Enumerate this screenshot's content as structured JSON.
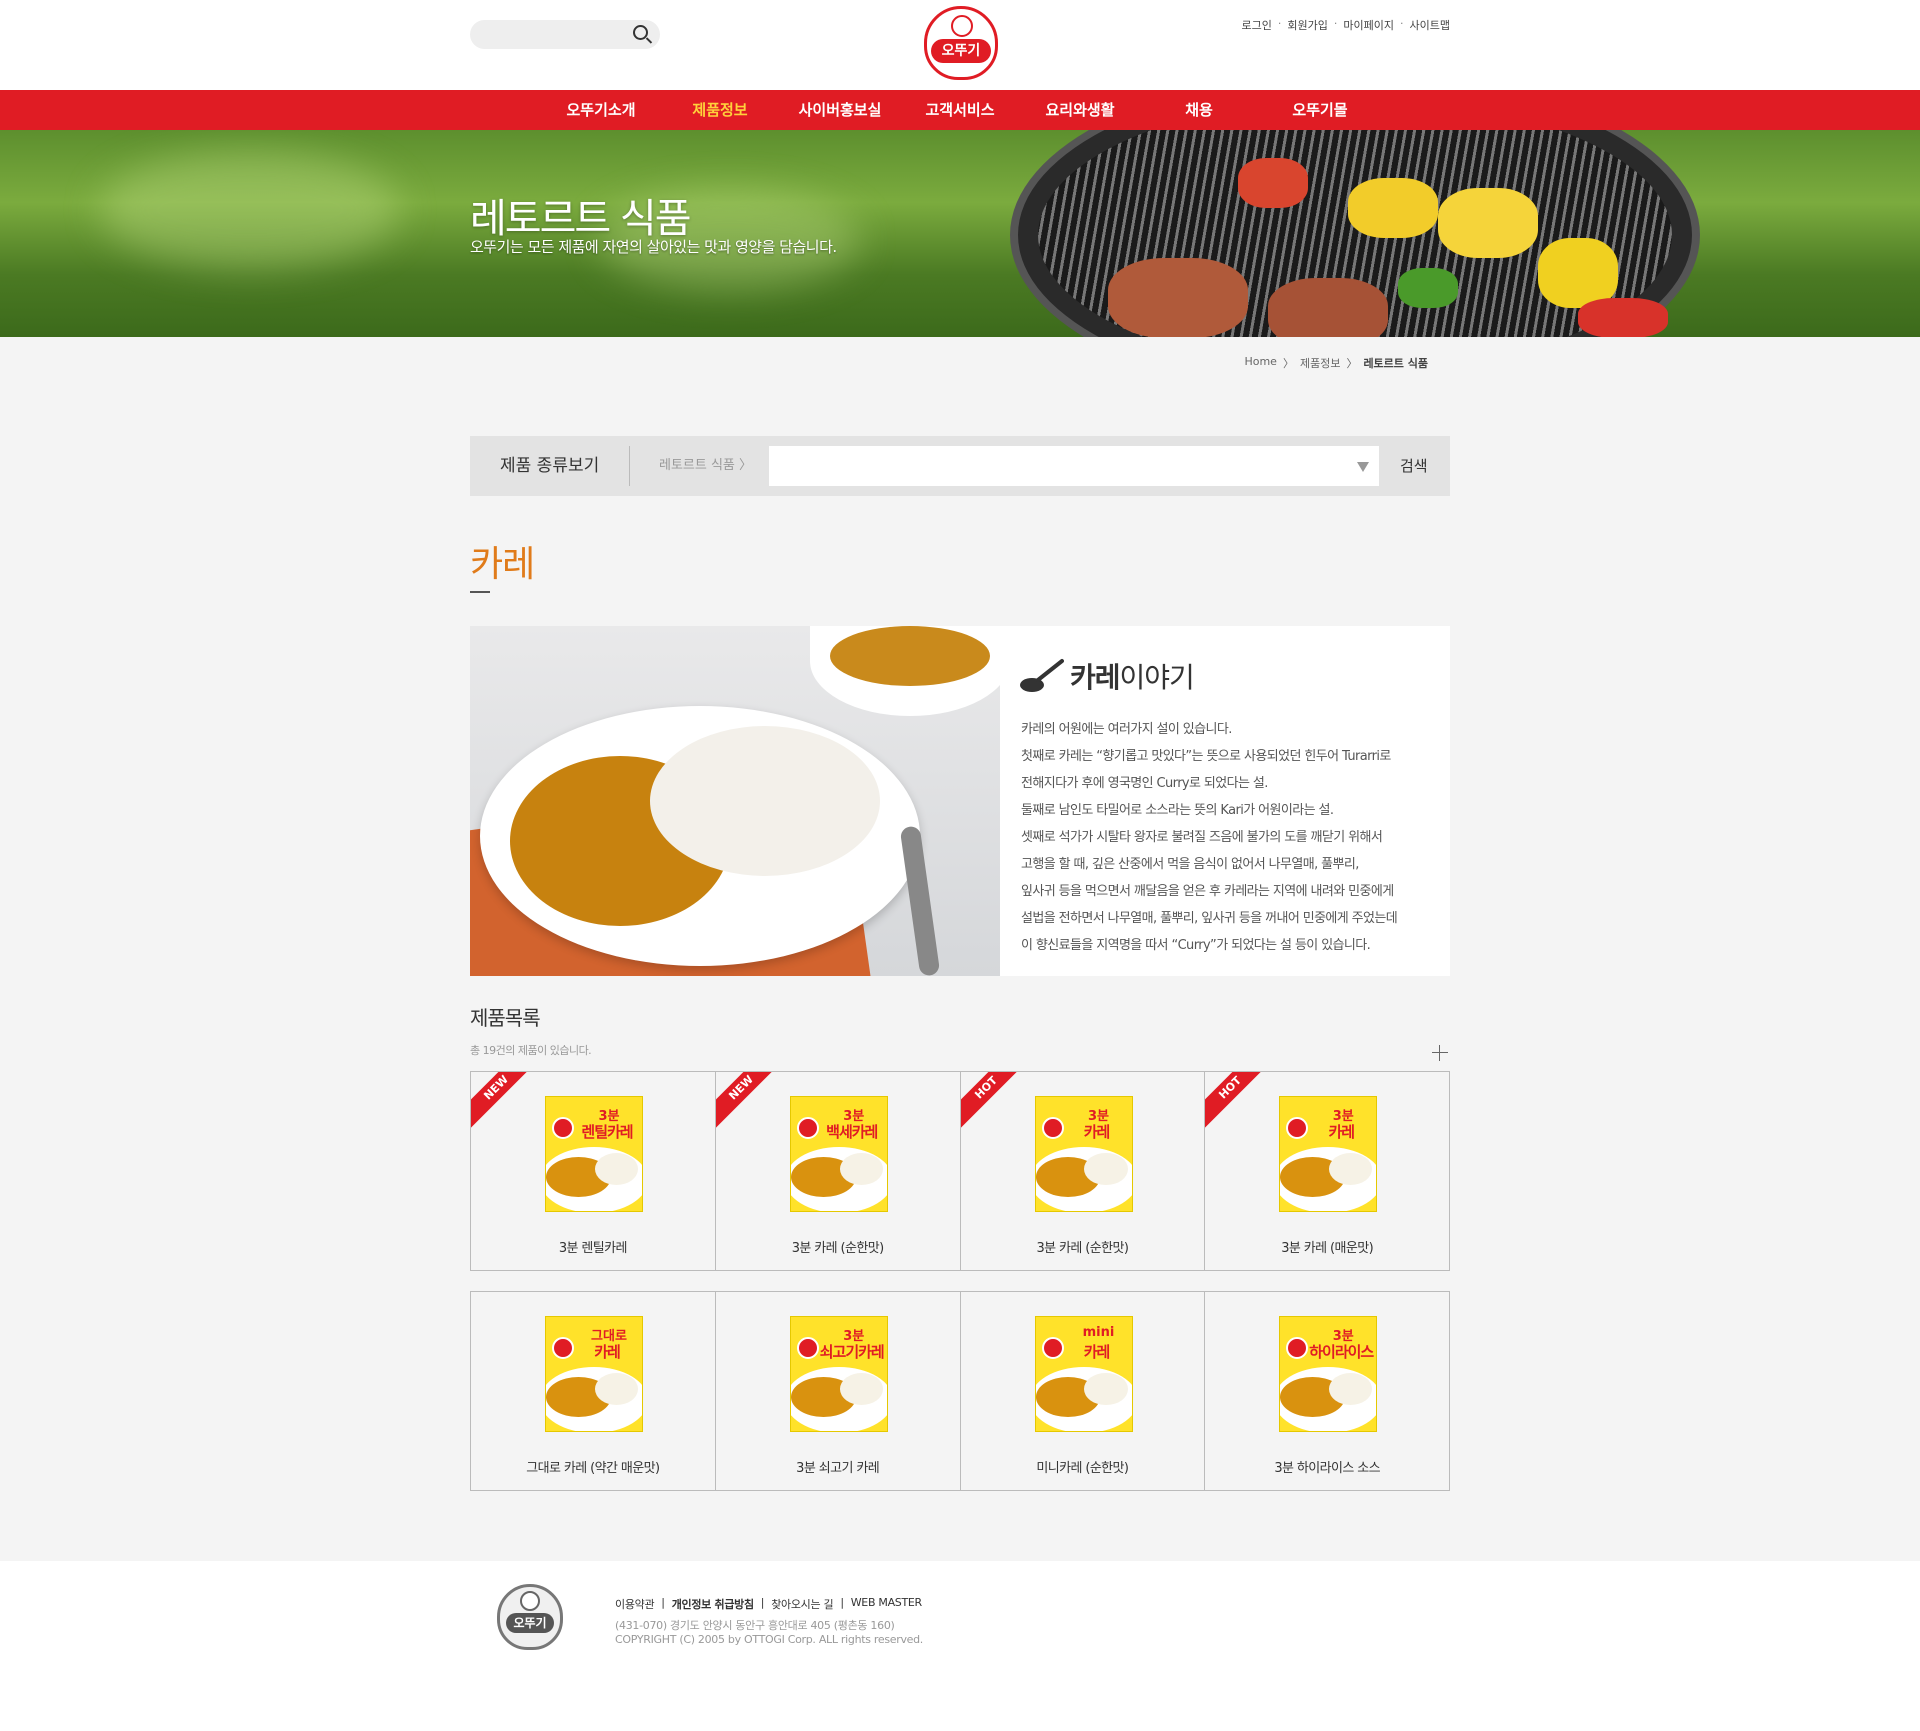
{
  "header": {
    "search": {
      "placeholder": "",
      "icon": "search-icon"
    },
    "logo_text": "오뚜기",
    "top_links": [
      "로그인",
      "회원가입",
      "마이페이지",
      "사이트맵"
    ]
  },
  "nav": {
    "items": [
      {
        "label": "오뚜기소개"
      },
      {
        "label": "제품정보",
        "active": true
      },
      {
        "label": "사이버홍보실"
      },
      {
        "label": "고객서비스"
      },
      {
        "label": "요리와생활"
      },
      {
        "label": "채용"
      },
      {
        "label": "오뚜기몰"
      }
    ],
    "color": "#e01c24",
    "active_color": "#ffd13b"
  },
  "hero": {
    "title": "레토르트 식품",
    "subtitle": "오뚜기는 모든 제품에 자연의 살아있는 맛과 영양을 담습니다."
  },
  "breadcrumb": [
    "Home",
    "제품정보",
    "레토르트 식품"
  ],
  "filter": {
    "label": "제품 종류보기",
    "category": "레토르트 식품 〉",
    "select_value": "",
    "search_button": "검색"
  },
  "category": {
    "title": "카레",
    "color": "#e07b1a"
  },
  "story": {
    "title_bold": "카레",
    "title_rest": "이야기",
    "lines": [
      "카레의 어원에는 여러가지 설이 있습니다.",
      "첫째로 카레는 “향기롭고 맛있다”는 뜻으로 사용되었던 힌두어 Turarri로",
      "전해지다가 후에 영국명인 Curry로 되었다는 설.",
      "둘째로 남인도 타밀어로 소스라는 뜻의 Kari가 어원이라는 설.",
      "셋째로 석가가 시탈타 왕자로 불려질 즈음에 불가의 도를 깨닫기 위해서",
      "고행을 할 때, 깊은 산중에서 먹을 음식이 없어서 나무열매, 풀뿌리,",
      "잎사귀 등을 먹으면서 깨달음을 얻은 후 카레라는 지역에 내려와 민중에게",
      "설법을 전하면서 나무열매, 풀뿌리, 잎사귀 등을 꺼내어 민중에게 주었는데",
      "이 향신료들을 지역명을 따서 “Curry”가 되었다는 설 등이 있습니다."
    ]
  },
  "products": {
    "title": "제품목록",
    "count_text": "총 19건의 제품이 있습니다.",
    "rows": [
      [
        {
          "name": "3분 렌틸카레",
          "badge": "NEW",
          "pack_top": "3분",
          "pack_name": "렌틸카레"
        },
        {
          "name": "3분 카레 (순한맛)",
          "badge": "NEW",
          "pack_top": "3분",
          "pack_name": "백세카레"
        },
        {
          "name": "3분 카레 (순한맛)",
          "badge": "HOT",
          "pack_top": "3분",
          "pack_name": "카레"
        },
        {
          "name": "3분 카레 (매운맛)",
          "badge": "HOT",
          "pack_top": "3분",
          "pack_name": "카레"
        }
      ],
      [
        {
          "name": "그대로 카레 (약간 매운맛)",
          "badge": "",
          "pack_top": "그대로",
          "pack_name": "카레"
        },
        {
          "name": "3분 쇠고기 카레",
          "badge": "",
          "pack_top": "3분",
          "pack_name": "쇠고기카레"
        },
        {
          "name": "미니카레 (순한맛)",
          "badge": "",
          "pack_top": "mini",
          "pack_name": "카레"
        },
        {
          "name": "3분 하이라이스 소스",
          "badge": "",
          "pack_top": "3분",
          "pack_name": "하이라이스"
        }
      ]
    ]
  },
  "footer": {
    "links": [
      "이용약관",
      "개인정보 취급방침",
      "찾아오시는 길",
      "WEB MASTER"
    ],
    "address": "(431-070) 경기도 안양시 동안구 흥안대로 405 (평촌동 160)",
    "copyright": "COPYRIGHT (C) 2005 by OTTOGI Corp. ALL rights reserved."
  }
}
